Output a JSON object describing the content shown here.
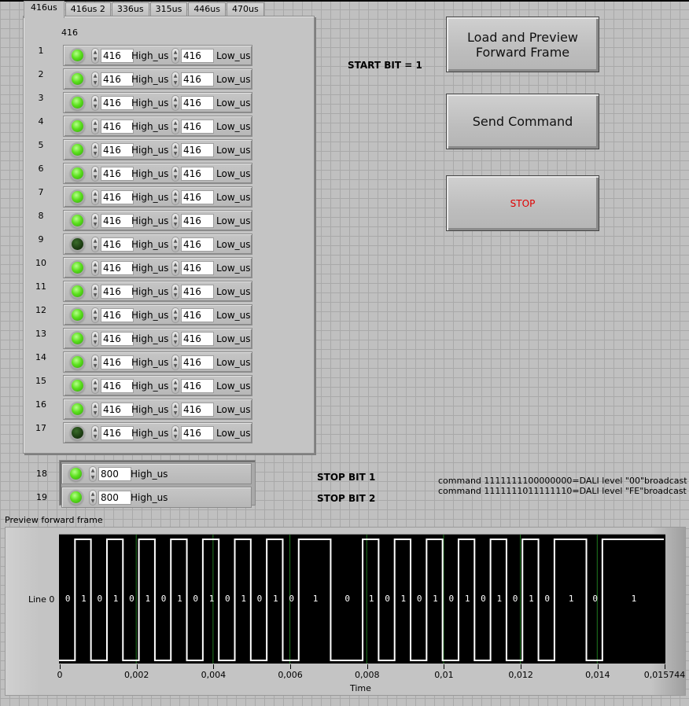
{
  "tabs": [
    {
      "label": "416us",
      "active": true
    },
    {
      "label": "416us 2",
      "active": false
    },
    {
      "label": "336us",
      "active": false
    },
    {
      "label": "315us",
      "active": false
    },
    {
      "label": "446us",
      "active": false
    },
    {
      "label": "470us",
      "active": false
    }
  ],
  "cluster_label": "416",
  "bit_rows": [
    {
      "index": "1",
      "led": "on",
      "high": "416",
      "high_label": "High_us",
      "low": "416",
      "low_label": "Low_us"
    },
    {
      "index": "2",
      "led": "on",
      "high": "416",
      "high_label": "High_us",
      "low": "416",
      "low_label": "Low_us"
    },
    {
      "index": "3",
      "led": "on",
      "high": "416",
      "high_label": "High_us",
      "low": "416",
      "low_label": "Low_us"
    },
    {
      "index": "4",
      "led": "on",
      "high": "416",
      "high_label": "High_us",
      "low": "416",
      "low_label": "Low_us"
    },
    {
      "index": "5",
      "led": "on",
      "high": "416",
      "high_label": "High_us",
      "low": "416",
      "low_label": "Low_us"
    },
    {
      "index": "6",
      "led": "on",
      "high": "416",
      "high_label": "High_us",
      "low": "416",
      "low_label": "Low_us"
    },
    {
      "index": "7",
      "led": "on",
      "high": "416",
      "high_label": "High_us",
      "low": "416",
      "low_label": "Low_us"
    },
    {
      "index": "8",
      "led": "on",
      "high": "416",
      "high_label": "High_us",
      "low": "416",
      "low_label": "Low_us"
    },
    {
      "index": "9",
      "led": "off",
      "high": "416",
      "high_label": "High_us",
      "low": "416",
      "low_label": "Low_us"
    },
    {
      "index": "10",
      "led": "on",
      "high": "416",
      "high_label": "High_us",
      "low": "416",
      "low_label": "Low_us"
    },
    {
      "index": "11",
      "led": "on",
      "high": "416",
      "high_label": "High_us",
      "low": "416",
      "low_label": "Low_us"
    },
    {
      "index": "12",
      "led": "on",
      "high": "416",
      "high_label": "High_us",
      "low": "416",
      "low_label": "Low_us"
    },
    {
      "index": "13",
      "led": "on",
      "high": "416",
      "high_label": "High_us",
      "low": "416",
      "low_label": "Low_us"
    },
    {
      "index": "14",
      "led": "on",
      "high": "416",
      "high_label": "High_us",
      "low": "416",
      "low_label": "Low_us"
    },
    {
      "index": "15",
      "led": "on",
      "high": "416",
      "high_label": "High_us",
      "low": "416",
      "low_label": "Low_us"
    },
    {
      "index": "16",
      "led": "on",
      "high": "416",
      "high_label": "High_us",
      "low": "416",
      "low_label": "Low_us"
    },
    {
      "index": "17",
      "led": "off",
      "high": "416",
      "high_label": "High_us",
      "low": "416",
      "low_label": "Low_us"
    }
  ],
  "stop_rows": [
    {
      "index": "18",
      "led": "on",
      "high": "800",
      "high_label": "High_us"
    },
    {
      "index": "19",
      "led": "on",
      "high": "800",
      "high_label": "High_us"
    }
  ],
  "labels": {
    "start_bit": "START BIT = 1",
    "stop_bit_1": "STOP BIT 1",
    "stop_bit_2": "STOP BIT 2",
    "command_1": "command 1111111100000000=DALI level \"00\"broadcast",
    "command_2": "command 1111111011111110=DALI level \"FE\"broadcast"
  },
  "buttons": {
    "load_preview": "Load and Preview\nForward Frame",
    "send_command": "Send Command",
    "stop": "STOP"
  },
  "colors": {
    "led_on": "#5ce01e",
    "led_off": "#1c3c12",
    "stop_text": "#e00000",
    "plot_bg": "#000000",
    "trace": "#ffffff",
    "cursor_lines": "#1f7a1f"
  },
  "chart_data": {
    "type": "line",
    "title": "Preview forward frame",
    "series_name": "Line 0",
    "xlabel": "Time",
    "ylabel": "",
    "xlim": [
      0,
      0.015744
    ],
    "x_ticks": [
      "0",
      "0,002",
      "0,004",
      "0,006",
      "0,008",
      "0,01",
      "0,012",
      "0,014",
      "0,015744"
    ],
    "x_tick_values": [
      0,
      0.002,
      0.004,
      0.006,
      0.008,
      0.01,
      0.012,
      0.014,
      0.015744
    ],
    "grid_lines_x": [
      0.002,
      0.004,
      0.006,
      0.008,
      0.01,
      0.012,
      0.014
    ],
    "grid": true,
    "segments": [
      {
        "level": 0,
        "duration_us": 416,
        "label": "0"
      },
      {
        "level": 1,
        "duration_us": 416,
        "label": "1"
      },
      {
        "level": 0,
        "duration_us": 416,
        "label": "0"
      },
      {
        "level": 1,
        "duration_us": 416,
        "label": "1"
      },
      {
        "level": 0,
        "duration_us": 416,
        "label": "0"
      },
      {
        "level": 1,
        "duration_us": 416,
        "label": "1"
      },
      {
        "level": 0,
        "duration_us": 416,
        "label": "0"
      },
      {
        "level": 1,
        "duration_us": 416,
        "label": "1"
      },
      {
        "level": 0,
        "duration_us": 416,
        "label": "0"
      },
      {
        "level": 1,
        "duration_us": 416,
        "label": "1"
      },
      {
        "level": 0,
        "duration_us": 416,
        "label": "0"
      },
      {
        "level": 1,
        "duration_us": 416,
        "label": "1"
      },
      {
        "level": 0,
        "duration_us": 416,
        "label": "0"
      },
      {
        "level": 1,
        "duration_us": 416,
        "label": "1"
      },
      {
        "level": 0,
        "duration_us": 416,
        "label": "0"
      },
      {
        "level": 1,
        "duration_us": 832,
        "label": "1"
      },
      {
        "level": 0,
        "duration_us": 832,
        "label": "0"
      },
      {
        "level": 1,
        "duration_us": 416,
        "label": "1"
      },
      {
        "level": 0,
        "duration_us": 416,
        "label": "0"
      },
      {
        "level": 1,
        "duration_us": 416,
        "label": "1"
      },
      {
        "level": 0,
        "duration_us": 416,
        "label": "0"
      },
      {
        "level": 1,
        "duration_us": 416,
        "label": "1"
      },
      {
        "level": 0,
        "duration_us": 416,
        "label": "0"
      },
      {
        "level": 1,
        "duration_us": 416,
        "label": "1"
      },
      {
        "level": 0,
        "duration_us": 416,
        "label": "0"
      },
      {
        "level": 1,
        "duration_us": 416,
        "label": "1"
      },
      {
        "level": 0,
        "duration_us": 416,
        "label": "0"
      },
      {
        "level": 1,
        "duration_us": 416,
        "label": "1"
      },
      {
        "level": 0,
        "duration_us": 416,
        "label": "0"
      },
      {
        "level": 1,
        "duration_us": 832,
        "label": "1"
      },
      {
        "level": 0,
        "duration_us": 416,
        "label": "0"
      },
      {
        "level": 1,
        "duration_us": 1600,
        "label": "1"
      }
    ]
  }
}
